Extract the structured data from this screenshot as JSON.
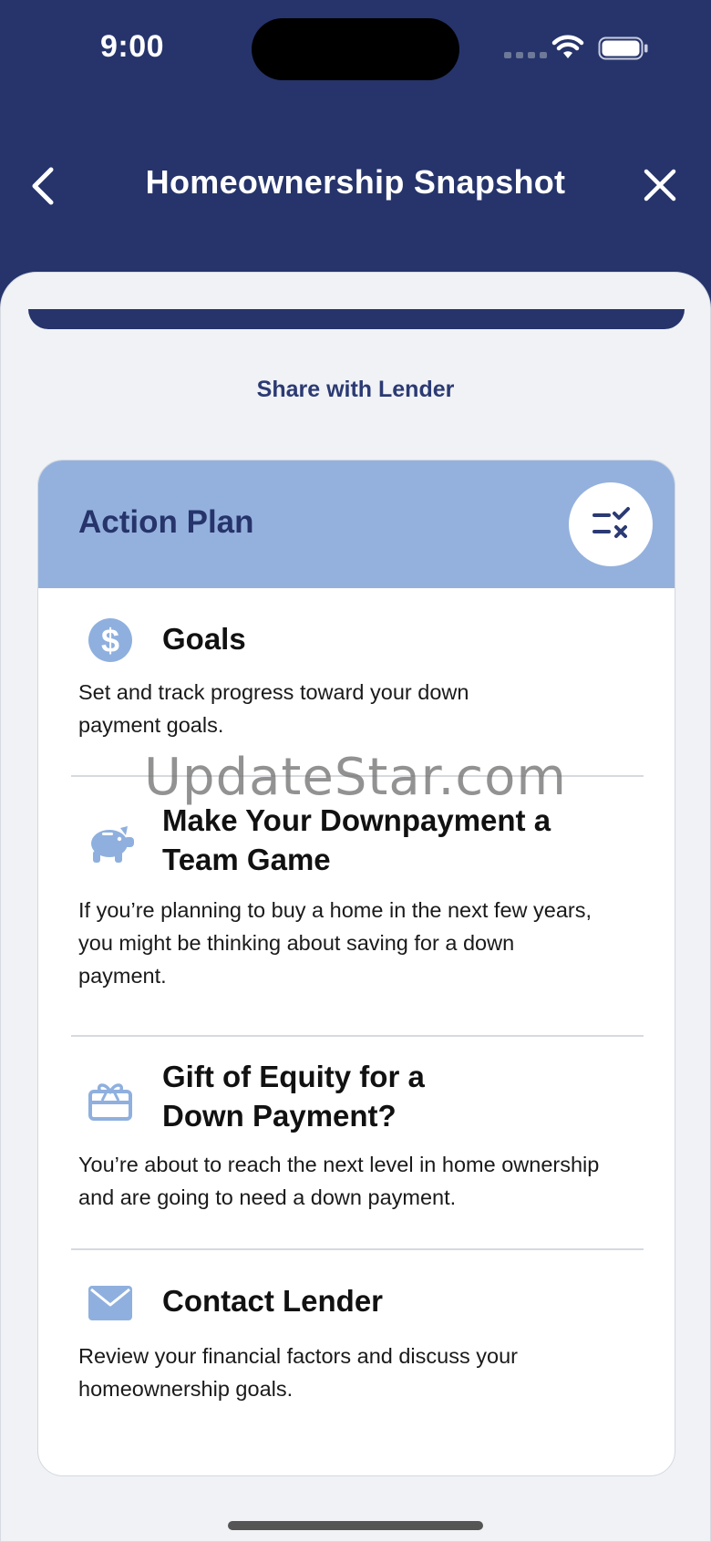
{
  "status_bar": {
    "time": "9:00"
  },
  "nav": {
    "title": "Homeownership Snapshot"
  },
  "share_label": "Share with Lender",
  "action_plan": {
    "title": "Action Plan",
    "items": [
      {
        "title": "Goals",
        "description": "Set and track progress toward your down payment goals.",
        "icon": "dollar-icon"
      },
      {
        "title": "Make Your Downpayment a Team Game",
        "description": "If you’re planning to buy a home in the next few years, you might be thinking about saving for a down payment.",
        "icon": "piggy-bank-icon"
      },
      {
        "title": "Gift of Equity for a Down Payment?",
        "description": "You’re about to reach the next level in home ownership and are going to need a down payment.",
        "icon": "gift-icon"
      },
      {
        "title": "Contact Lender",
        "description": "Review your financial factors and discuss your homeownership goals.",
        "icon": "mail-icon"
      }
    ]
  },
  "watermark": "UpdateStar.com",
  "colors": {
    "navy": "#26346b",
    "header_blue": "#94b1dd",
    "icon_blue": "#8fb0de"
  }
}
